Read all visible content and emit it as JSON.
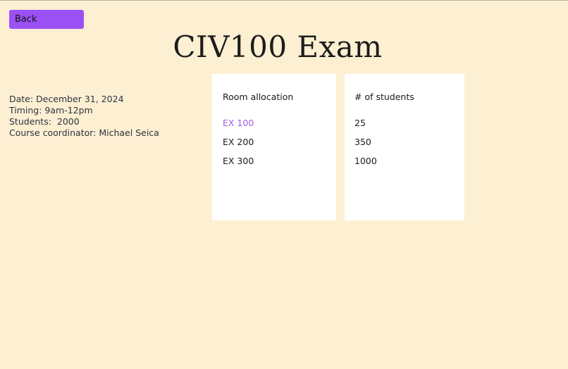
{
  "back_button": {
    "label": "Back"
  },
  "page": {
    "title": "CIV100 Exam"
  },
  "exam_info": {
    "date": "Date: December 31, 2024",
    "timing": "Timing: 9am-12pm",
    "students": "Students:  2000",
    "coordinator": "Course coordinator: Michael Seica"
  },
  "rooms_card": {
    "header": "Room allocation",
    "rooms": [
      "EX 100",
      "EX 200",
      "EX 300"
    ]
  },
  "students_card": {
    "header": "# of students",
    "counts": [
      "25",
      "350",
      "1000"
    ]
  },
  "colors": {
    "background": "#fdefd2",
    "accent": "#9b51f5",
    "active_link": "#a15ce0"
  }
}
